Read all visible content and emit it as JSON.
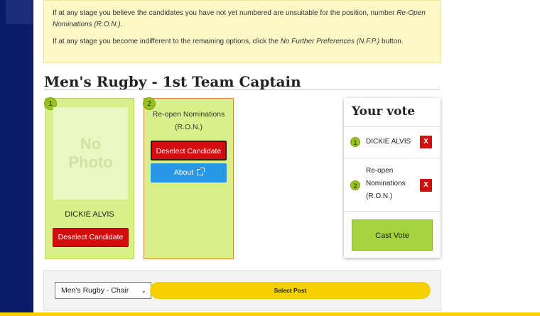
{
  "instructions": {
    "p1_pre": "If at any stage you believe the candidates you have not yet numbered are unsuitable for the position, number ",
    "p1_em": "Re-Open Nominations (R.O.N.).",
    "p2_pre": "If at any stage you become indifferent to the remaining options, click the ",
    "p2_em": "No Further Preferences (N.F.P.)",
    "p2_post": " button."
  },
  "section_title": "Men's Rugby - 1st Team Captain",
  "candidates": [
    {
      "rank": "1",
      "photo_text_1": "No",
      "photo_text_2": "Photo",
      "name": "DICKIE ALVIS",
      "deselect_label": "Deselect Candidate"
    },
    {
      "rank": "2",
      "name_line1": "Re-open Nominations",
      "name_line2": "(R.O.N.)",
      "deselect_label": "Deselect Candidate",
      "about_label": "About"
    }
  ],
  "vote_panel": {
    "title": "Your vote",
    "items": [
      {
        "rank": "1",
        "name": "DICKIE ALVIS",
        "remove": "X"
      },
      {
        "rank": "2",
        "name_lines": [
          "Re-open",
          "Nominations",
          "(R.O.N.)"
        ],
        "remove": "X"
      }
    ],
    "cast_label": "Cast Vote"
  },
  "post_selector": {
    "selected": "Men's Rugby - Chair",
    "button_label": "Select Post"
  },
  "colors": {
    "page_bg": "#0b1a6b",
    "candidate_card": "#d8f08a",
    "danger": "#d30d0d",
    "info": "#2a97e6",
    "accent_yellow": "#f4d000",
    "cast_green": "#a4d43d"
  },
  "icons": [
    "external-link-icon",
    "chevron-down-icon"
  ]
}
